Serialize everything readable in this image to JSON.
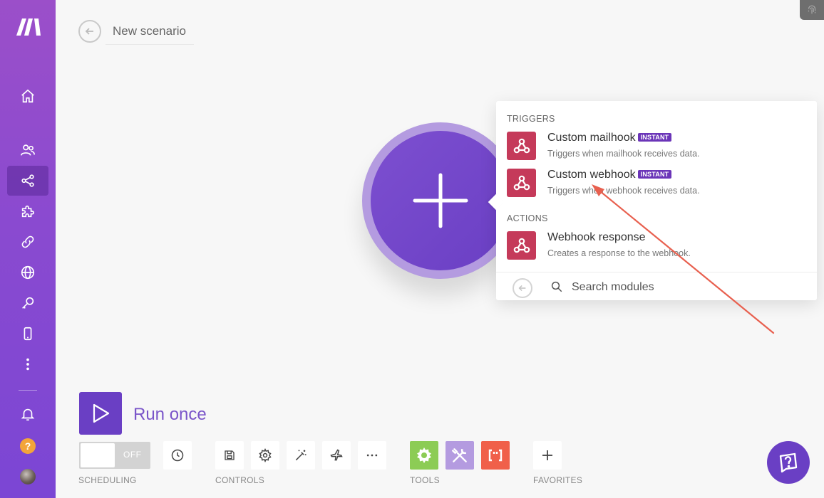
{
  "header": {
    "scenario_title": "New scenario"
  },
  "sidebar": {
    "items": [
      {
        "icon": "home-icon"
      },
      {
        "icon": "team-icon"
      },
      {
        "icon": "share-icon",
        "active": true
      },
      {
        "icon": "puzzle-icon"
      },
      {
        "icon": "link-icon"
      },
      {
        "icon": "globe-icon"
      },
      {
        "icon": "key-icon"
      },
      {
        "icon": "mobile-icon"
      },
      {
        "icon": "more-vertical-icon"
      },
      {
        "icon": "bell-icon"
      },
      {
        "icon": "help-icon",
        "label": "?"
      },
      {
        "icon": "user-avatar"
      }
    ]
  },
  "popover": {
    "triggers_label": "TRIGGERS",
    "actions_label": "ACTIONS",
    "modules": [
      {
        "title": "Custom mailhook",
        "badge": "INSTANT",
        "desc": "Triggers when mailhook receives data."
      },
      {
        "title": "Custom webhook",
        "badge": "INSTANT",
        "desc": "Triggers when webhook receives data."
      },
      {
        "title": "Webhook response",
        "badge": "",
        "desc": "Creates a response to the webhook."
      }
    ],
    "search_placeholder": "Search modules"
  },
  "bottom": {
    "run_label": "Run once",
    "toggle_state": "OFF",
    "labels": {
      "scheduling": "SCHEDULING",
      "controls": "CONTROLS",
      "tools": "TOOLS",
      "favorites": "FAVORITES"
    }
  },
  "colors": {
    "accent": "#6a3fc4",
    "webhook_icon": "#c53a5a",
    "tools_green": "#8ccc55",
    "tools_lavender": "#b49be0",
    "tools_coral": "#f0604a",
    "annotation_arrow": "#e8604f"
  }
}
